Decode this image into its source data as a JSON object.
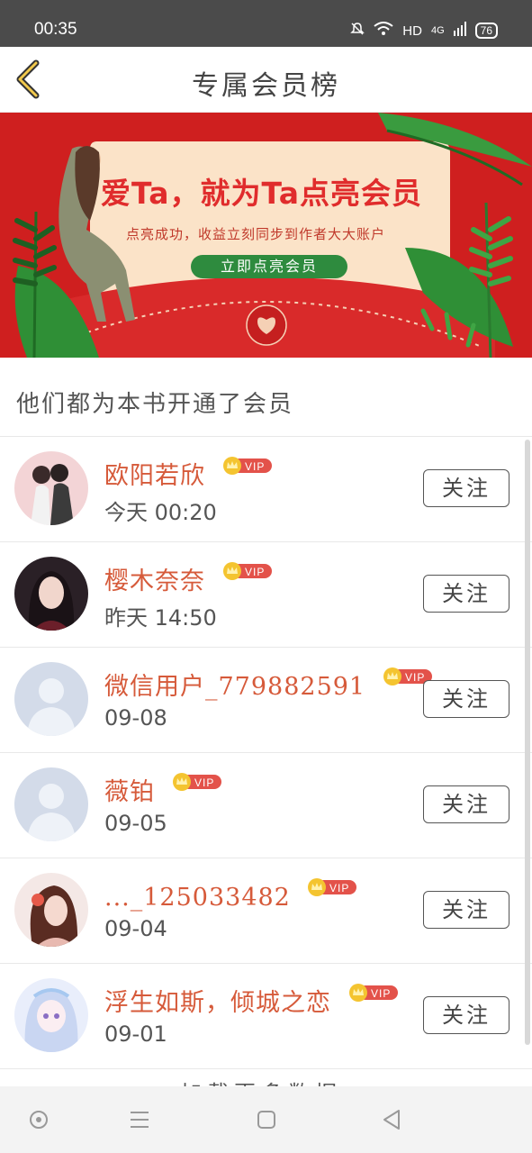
{
  "status_bar": {
    "time": "00:35",
    "network": "HD",
    "signal": "4G",
    "battery": "76"
  },
  "header": {
    "title": "专属会员榜"
  },
  "banner": {
    "headline": "爱Ta，就为Ta点亮会员",
    "subtitle": "点亮成功，收益立刻同步到作者大大账户",
    "button_label": "立即点亮会员"
  },
  "section": {
    "title": "他们都为本书开通了会员"
  },
  "members": [
    {
      "name": "欧阳若欣",
      "date": "今天 00:20",
      "badge": "VIP",
      "follow": "关注",
      "avatar": "photo-couple"
    },
    {
      "name": "樱木奈奈",
      "date": "昨天 14:50",
      "badge": "VIP",
      "follow": "关注",
      "avatar": "photo-woman"
    },
    {
      "name": "微信用户_779882591",
      "date": "09-08",
      "badge": "VIP",
      "follow": "关注",
      "avatar": "default-person"
    },
    {
      "name": "薇铂",
      "date": "09-05",
      "badge": "VIP",
      "follow": "关注",
      "avatar": "default-person"
    },
    {
      "name": "..._125033482",
      "date": "09-04",
      "badge": "VIP",
      "follow": "关注",
      "avatar": "photo-woman-flower"
    },
    {
      "name": "浮生如斯，倾城之恋",
      "date": "09-01",
      "badge": "VIP",
      "follow": "关注",
      "avatar": "anime-girl"
    }
  ],
  "footer_partial": "加载更多数据...",
  "colors": {
    "accent_name": "#d65a3a",
    "banner_red": "#cf1f1f",
    "vip_red": "#e3524a",
    "crown_gold": "#f4c430"
  }
}
